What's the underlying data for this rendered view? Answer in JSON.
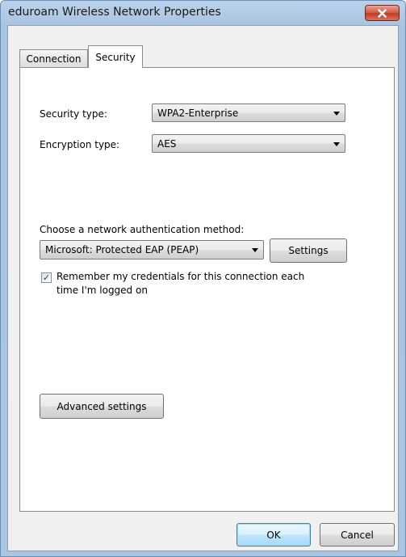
{
  "window": {
    "title": "eduroam Wireless Network Properties"
  },
  "tabs": [
    {
      "label": "Connection"
    },
    {
      "label": "Security"
    }
  ],
  "security": {
    "security_type_label": "Security type:",
    "security_type_value": "WPA2-Enterprise",
    "encryption_type_label": "Encryption type:",
    "encryption_type_value": "AES",
    "auth_method_label": "Choose a network authentication method:",
    "auth_method_value": "Microsoft: Protected EAP (PEAP)",
    "settings_button": "Settings",
    "remember_checked": true,
    "remember_label_line1": "Remember my credentials for this connection each",
    "remember_label_line2": "time I'm logged on",
    "advanced_button": "Advanced settings"
  },
  "footer": {
    "ok_label": "OK",
    "cancel_label": "Cancel"
  },
  "icons": {
    "close": "close-icon",
    "dropdown": "chevron-down-icon",
    "check": "checkmark-icon"
  },
  "colors": {
    "title_bar": "#aac5e1",
    "close_button": "#c23b22",
    "default_button_border": "#3c7fb1"
  }
}
